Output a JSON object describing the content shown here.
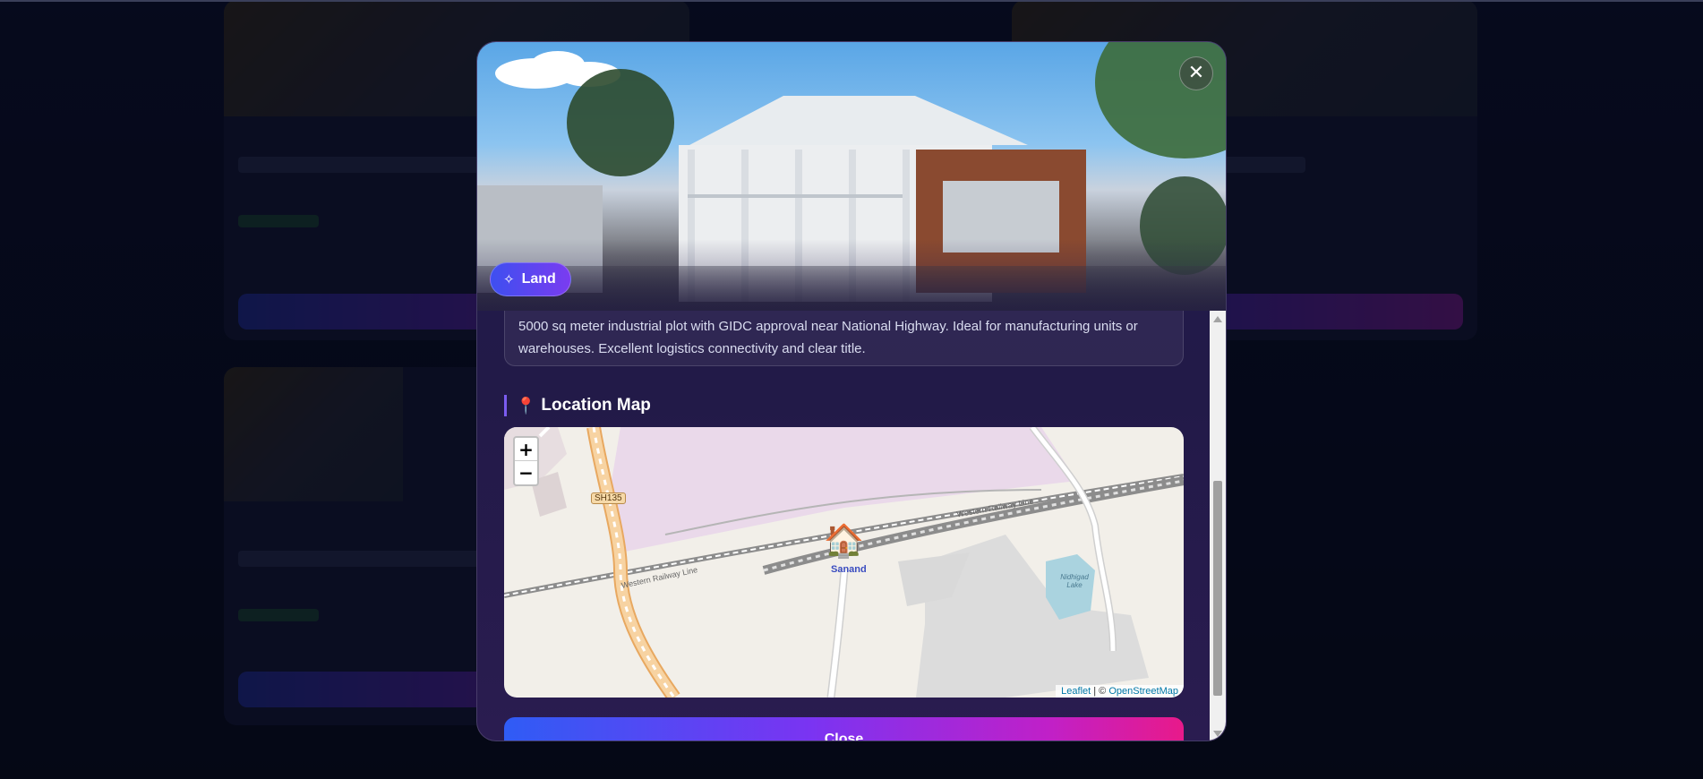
{
  "modal": {
    "close_icon": "close-icon",
    "category_badge": {
      "label": "Land",
      "icon": "sparkles-icon"
    },
    "description": "5000 sq meter industrial plot with GIDC approval near National Highway. Ideal for manufacturing units or warehouses. Excellent logistics connectivity and clear title.",
    "map_section": {
      "title": "Location Map",
      "icon": "pin-icon",
      "zoom_in": "+",
      "zoom_out": "−",
      "marker_label": "Sanand",
      "road_label": "SH135",
      "rail_label_1": "Western Railway Line",
      "rail_label_2": "Western Railway Line",
      "lake_label": "Nidhigad Lake",
      "attribution_leaflet": "Leaflet",
      "attribution_sep": " | © ",
      "attribution_osm": "OpenStreetMap"
    },
    "close_button": "Close"
  },
  "colors": {
    "accent_gradient_start": "#2f5cf5",
    "accent_gradient_end": "#e81a8a",
    "modal_bg": "#241b4d",
    "badge_start": "#3e4ff0",
    "badge_end": "#7a3cf0"
  }
}
